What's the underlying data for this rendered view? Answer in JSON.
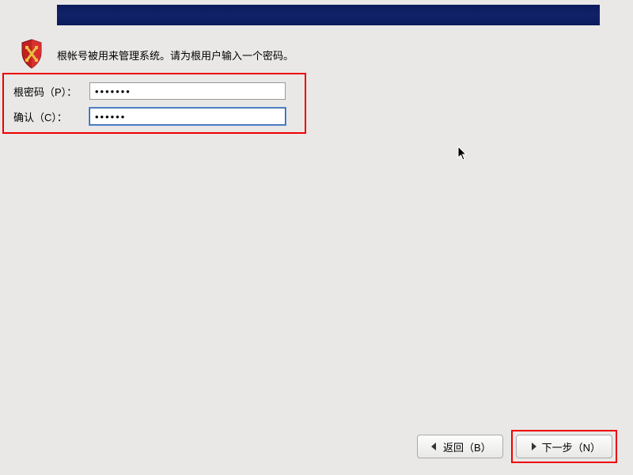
{
  "description": "根帐号被用来管理系统。请为根用户输入一个密码。",
  "form": {
    "password_label": "根密码（P）：",
    "password_value": "•••••••",
    "confirm_label": "确认（C）：",
    "confirm_value": "••••••"
  },
  "buttons": {
    "back_label": "返回（B）",
    "next_label": "下一步（N）"
  },
  "icons": {
    "shield": "shield-icon",
    "arrow_left": "arrow-left-icon",
    "arrow_right": "arrow-right-icon"
  }
}
